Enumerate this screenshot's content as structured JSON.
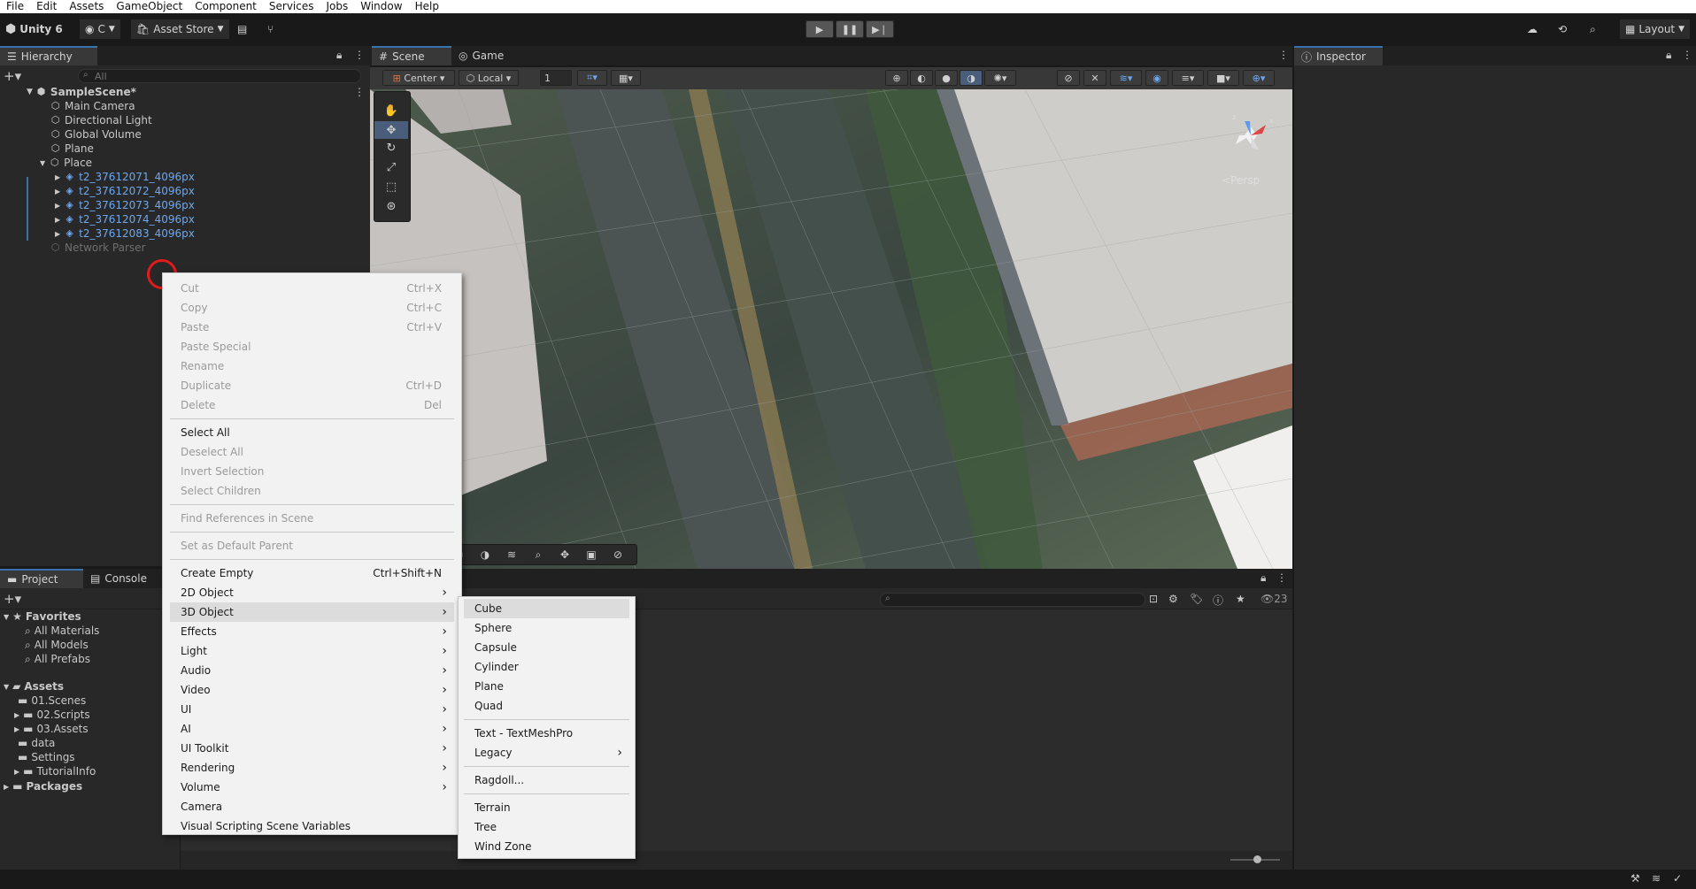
{
  "menubar": [
    "File",
    "Edit",
    "Assets",
    "GameObject",
    "Component",
    "Services",
    "Jobs",
    "Window",
    "Help"
  ],
  "toolbar": {
    "unity_version": "Unity 6",
    "account": "C",
    "asset_store": "Asset Store",
    "layout": "Layout"
  },
  "hierarchy": {
    "tab": "Hierarchy",
    "search_placeholder": "All",
    "scene": "SampleScene*",
    "items": [
      {
        "label": "Main Camera",
        "depth": 1,
        "color": "normal"
      },
      {
        "label": "Directional Light",
        "depth": 1,
        "color": "normal"
      },
      {
        "label": "Global Volume",
        "depth": 1,
        "color": "normal"
      },
      {
        "label": "Plane",
        "depth": 1,
        "color": "normal"
      },
      {
        "label": "Place",
        "depth": 1,
        "color": "normal"
      },
      {
        "label": "t2_37612071_4096px",
        "depth": 2,
        "color": "blue"
      },
      {
        "label": "t2_37612072_4096px",
        "depth": 2,
        "color": "blue"
      },
      {
        "label": "t2_37612073_4096px",
        "depth": 2,
        "color": "blue"
      },
      {
        "label": "t2_37612074_4096px",
        "depth": 2,
        "color": "blue"
      },
      {
        "label": "t2_37612083_4096px",
        "depth": 2,
        "color": "blue"
      },
      {
        "label": "Network Parser",
        "depth": 1,
        "color": "dim"
      }
    ]
  },
  "scene_tabs": {
    "scene": "Scene",
    "game": "Game"
  },
  "scene_toolbar": {
    "pivot": "Center",
    "space": "Local",
    "grid_value": "1",
    "persp": "Persp"
  },
  "inspector": {
    "tab": "Inspector"
  },
  "project": {
    "tab_project": "Project",
    "tab_console": "Console",
    "favorites": "Favorites",
    "fav_items": [
      "All Materials",
      "All Models",
      "All Prefabs"
    ],
    "assets": "Assets",
    "asset_items": [
      "01.Scenes",
      "02.Scripts",
      "03.Assets",
      "data",
      "Settings",
      "TutorialInfo"
    ],
    "packages": "Packages",
    "count": "23"
  },
  "context_menu": {
    "groups": [
      [
        {
          "label": "Cut",
          "shortcut": "Ctrl+X",
          "enabled": false
        },
        {
          "label": "Copy",
          "shortcut": "Ctrl+C",
          "enabled": false
        },
        {
          "label": "Paste",
          "shortcut": "Ctrl+V",
          "enabled": false
        },
        {
          "label": "Paste Special",
          "shortcut": "",
          "enabled": false
        },
        {
          "label": "Rename",
          "shortcut": "",
          "enabled": false
        },
        {
          "label": "Duplicate",
          "shortcut": "Ctrl+D",
          "enabled": false
        },
        {
          "label": "Delete",
          "shortcut": "Del",
          "enabled": false
        }
      ],
      [
        {
          "label": "Select All",
          "shortcut": "",
          "enabled": true
        },
        {
          "label": "Deselect All",
          "shortcut": "",
          "enabled": false
        },
        {
          "label": "Invert Selection",
          "shortcut": "",
          "enabled": false
        },
        {
          "label": "Select Children",
          "shortcut": "",
          "enabled": false
        }
      ],
      [
        {
          "label": "Find References in Scene",
          "shortcut": "",
          "enabled": false
        }
      ],
      [
        {
          "label": "Set as Default Parent",
          "shortcut": "",
          "enabled": false
        }
      ],
      [
        {
          "label": "Create Empty",
          "shortcut": "Ctrl+Shift+N",
          "enabled": true
        },
        {
          "label": "2D Object",
          "submenu": true,
          "enabled": true
        },
        {
          "label": "3D Object",
          "submenu": true,
          "enabled": true,
          "highlighted": true
        },
        {
          "label": "Effects",
          "submenu": true,
          "enabled": true
        },
        {
          "label": "Light",
          "submenu": true,
          "enabled": true
        },
        {
          "label": "Audio",
          "submenu": true,
          "enabled": true
        },
        {
          "label": "Video",
          "submenu": true,
          "enabled": true
        },
        {
          "label": "UI",
          "submenu": true,
          "enabled": true
        },
        {
          "label": "AI",
          "submenu": true,
          "enabled": true
        },
        {
          "label": "UI Toolkit",
          "submenu": true,
          "enabled": true
        },
        {
          "label": "Rendering",
          "submenu": true,
          "enabled": true
        },
        {
          "label": "Volume",
          "submenu": true,
          "enabled": true
        },
        {
          "label": "Camera",
          "shortcut": "",
          "enabled": true
        },
        {
          "label": "Visual Scripting Scene Variables",
          "shortcut": "",
          "enabled": true
        }
      ]
    ]
  },
  "submenu_3d": {
    "groups": [
      [
        {
          "label": "Cube",
          "highlighted": true
        },
        {
          "label": "Sphere"
        },
        {
          "label": "Capsule"
        },
        {
          "label": "Cylinder"
        },
        {
          "label": "Plane"
        },
        {
          "label": "Quad"
        }
      ],
      [
        {
          "label": "Text - TextMeshPro"
        },
        {
          "label": "Legacy",
          "submenu": true
        }
      ],
      [
        {
          "label": "Ragdoll..."
        }
      ],
      [
        {
          "label": "Terrain"
        },
        {
          "label": "Tree"
        },
        {
          "label": "Wind Zone"
        }
      ]
    ]
  }
}
